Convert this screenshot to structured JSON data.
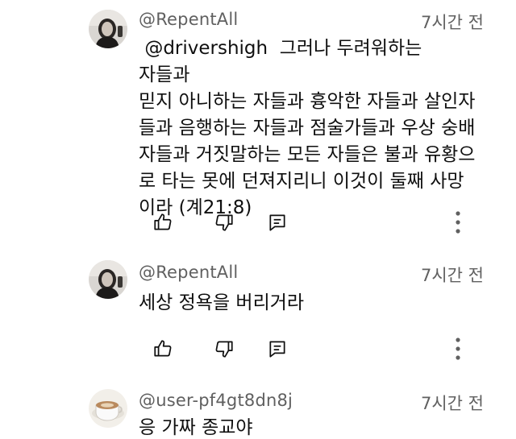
{
  "comments": [
    {
      "author": "@RepentAll",
      "time": "7시간 전",
      "mention": "@drivershigh",
      "lines": [
        "그러나 두려워하는 자들과",
        "믿지 아니하는 자들과 흉악한 자들과 살인자",
        "들과 음행하는 자들과 점술가들과 우상 숭배",
        "자들과 거짓말하는 모든 자들은 불과 유황으",
        "로 타는 못에 던져지리니 이것이 둘째 사망",
        "이라 (계21:8)"
      ],
      "avatar": "person-avatar"
    },
    {
      "author": "@RepentAll",
      "time": "7시간 전",
      "lines": [
        "세상 정욕을 버리거라"
      ],
      "avatar": "person-avatar"
    },
    {
      "author": "@user-pf4gt8dn8j",
      "time": "7시간 전",
      "lines": [
        "응 가짜 종교야"
      ],
      "avatar": "coffee-cup-avatar"
    }
  ],
  "icons": {
    "like": "thumbs-up-icon",
    "dislike": "thumbs-down-icon",
    "reply": "reply-icon",
    "more": "more-vertical-icon"
  }
}
